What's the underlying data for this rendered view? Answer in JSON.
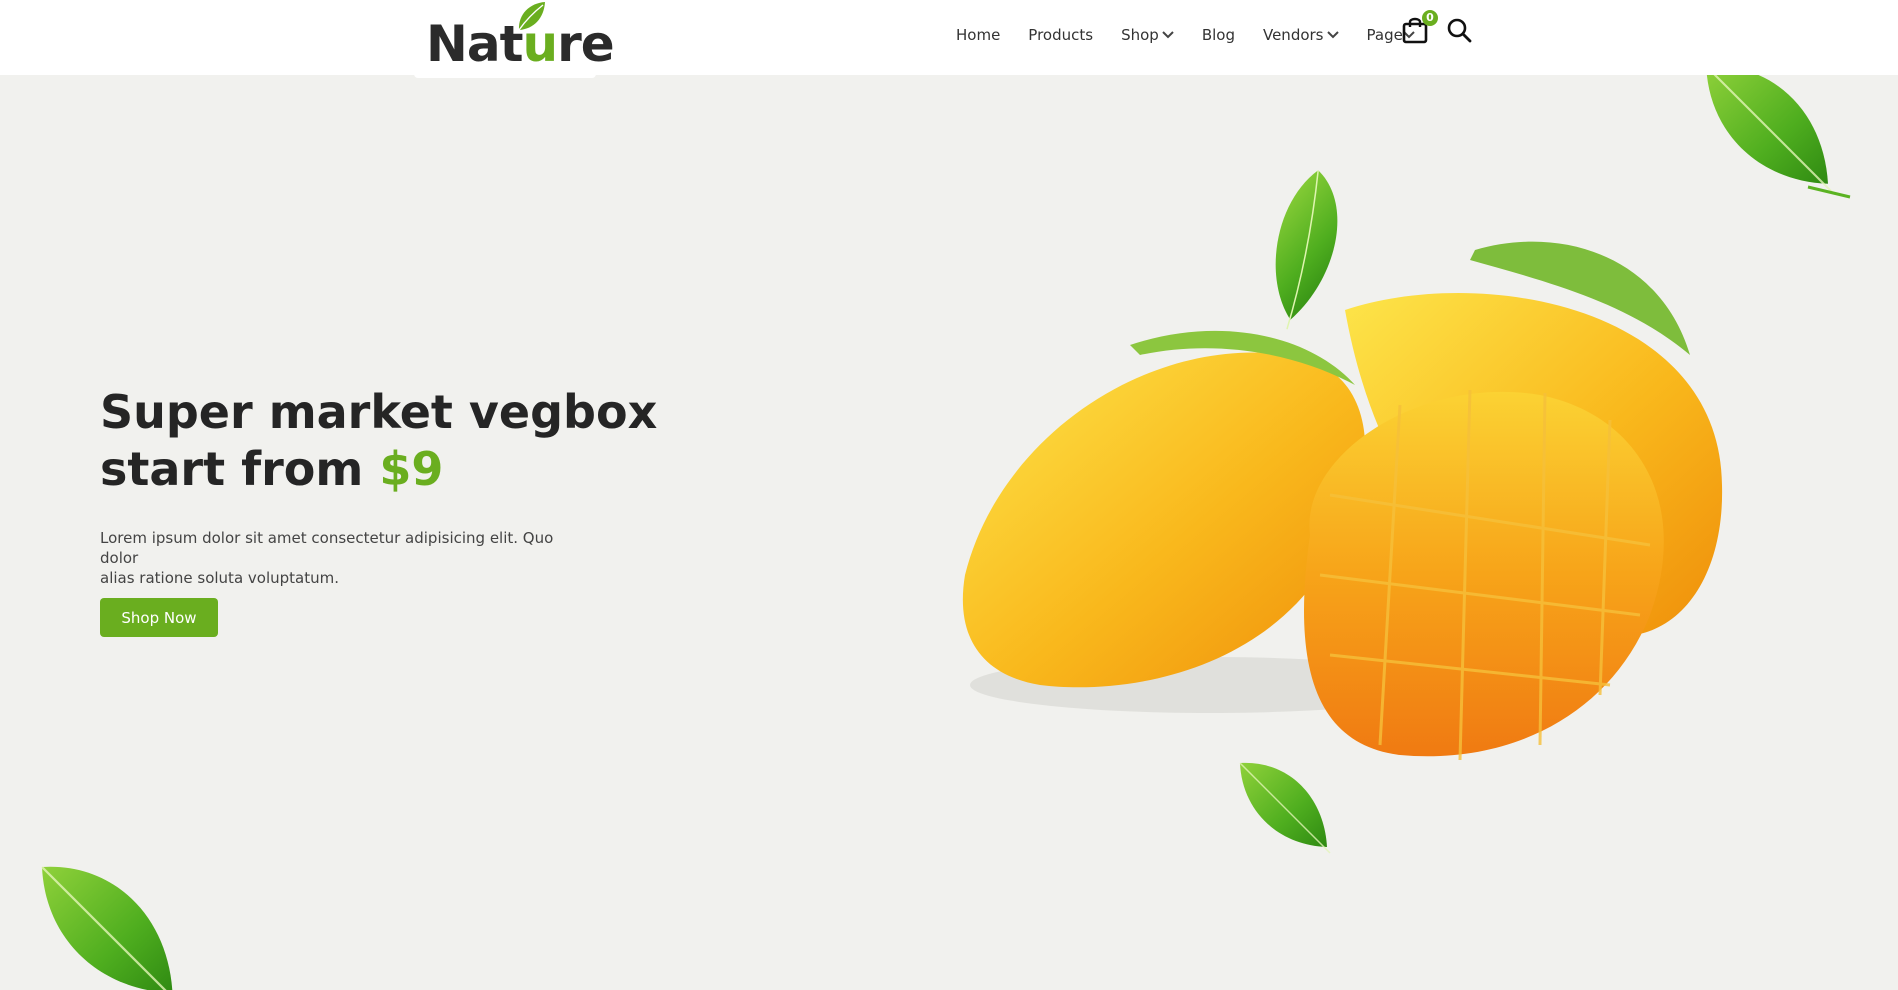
{
  "brand": {
    "logo_prefix": "Nat",
    "logo_accent": "u",
    "logo_suffix": "re",
    "accent_color": "#6aae1f"
  },
  "nav": {
    "items": [
      {
        "label": "Home",
        "dropdown": false
      },
      {
        "label": "Products",
        "dropdown": false
      },
      {
        "label": "Shop",
        "dropdown": true
      },
      {
        "label": "Blog",
        "dropdown": false
      },
      {
        "label": "Vendors",
        "dropdown": true
      },
      {
        "label": "Page",
        "dropdown": true
      }
    ],
    "cart_count": "0",
    "cart_icon": "shopping-bag-icon",
    "search_icon": "search-icon"
  },
  "hero": {
    "headline_line1": "Super market vegbox",
    "headline_line2_prefix": "start from ",
    "headline_price": "$9",
    "description_line1": "Lorem ipsum dolor sit amet consectetur adipisicing elit. Quo dolor",
    "description_line2": "alias ratione soluta voluptatum.",
    "cta_label": "Shop Now",
    "image": "mango-illustration"
  },
  "colors": {
    "background": "#f1f1ee",
    "header": "#ffffff",
    "mango": "#f7b21a",
    "leaf": "#4caf1c"
  }
}
